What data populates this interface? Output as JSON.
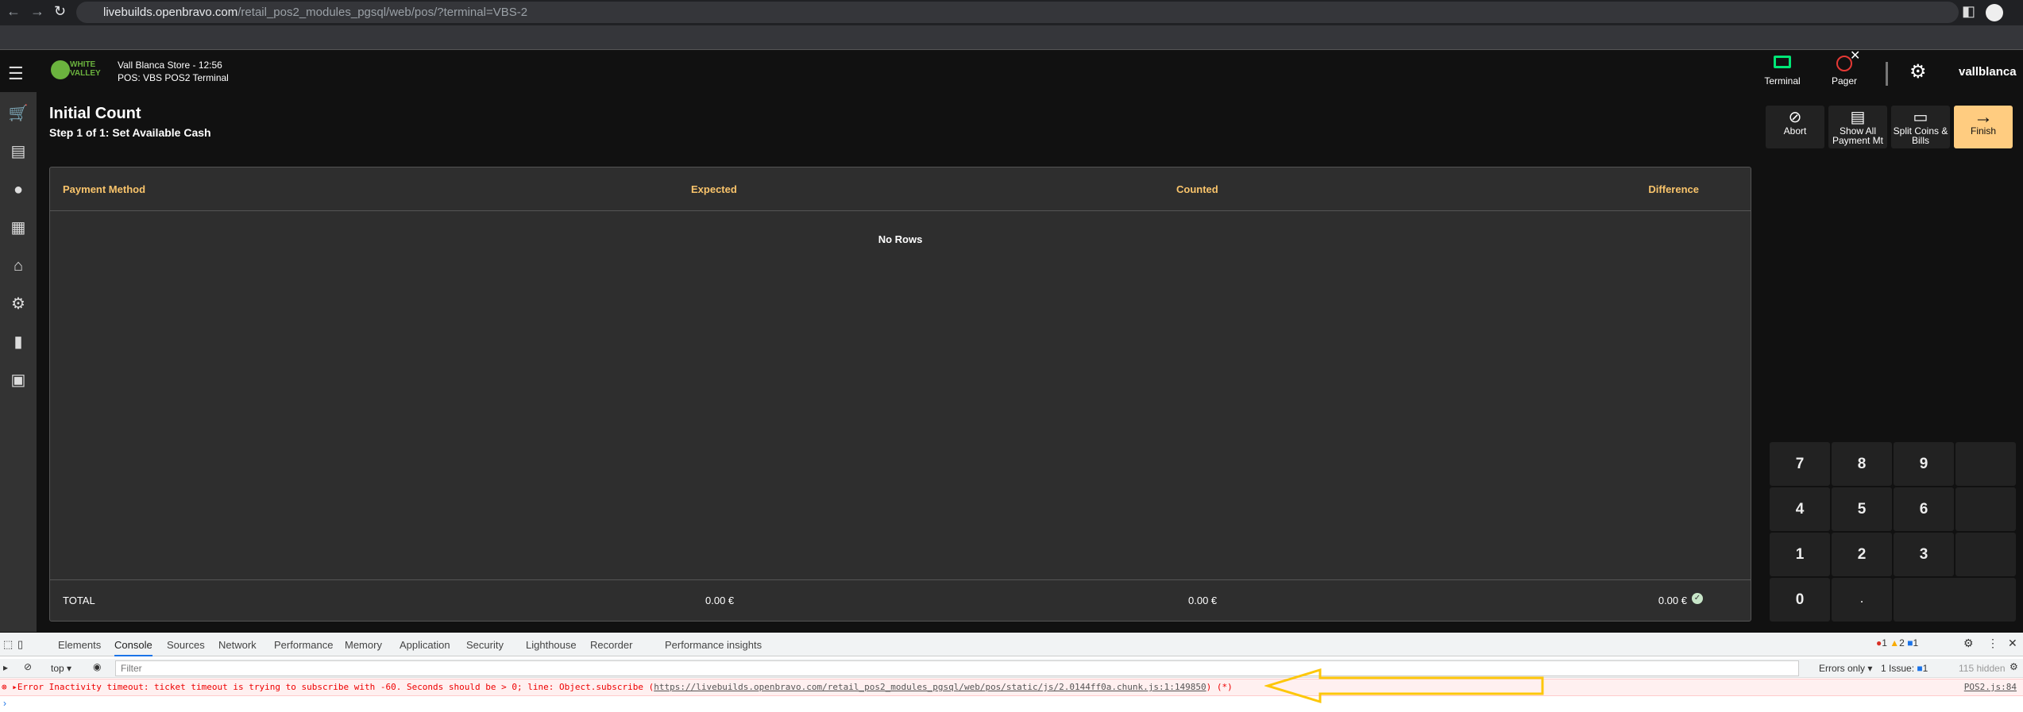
{
  "browser": {
    "url_host": "livebuilds.openbravo.com",
    "url_path": "/retail_pos2_modules_pgsql/web/pos/?terminal=VBS-2"
  },
  "header": {
    "logo_line1": "WHITE",
    "logo_line2": "VALLEY",
    "store": "Vall Blanca Store - 12:56",
    "terminal": "POS: VBS POS2 Terminal",
    "terminal_label": "Terminal",
    "pager_label": "Pager",
    "user": "vallblanca"
  },
  "page": {
    "title": "Initial Count",
    "step": "Step 1 of 1: Set Available Cash"
  },
  "actions": {
    "abort": "Abort",
    "show_all": "Show All Payment Mt",
    "split": "Split Coins & Bills",
    "finish": "Finish"
  },
  "table": {
    "columns": [
      "Payment Method",
      "Expected",
      "Counted",
      "Difference"
    ],
    "empty": "No Rows",
    "total_label": "TOTAL",
    "total_expected": "0.00 €",
    "total_counted": "0.00 €",
    "total_difference": "0.00 €"
  },
  "keypad": {
    "keys": [
      "7",
      "8",
      "9",
      "4",
      "5",
      "6",
      "1",
      "2",
      "3",
      "0",
      "."
    ]
  },
  "devtools": {
    "tabs": [
      "Elements",
      "Console",
      "Sources",
      "Network",
      "Performance",
      "Memory",
      "Application",
      "Security",
      "Lighthouse",
      "Recorder",
      "Performance insights"
    ],
    "context": "top",
    "filter_placeholder": "Filter",
    "errors_count": "1",
    "warnings_count": "2",
    "info_count": "1",
    "levels": "Errors only",
    "issues": "1 Issue:",
    "issues_count": "1",
    "hidden": "115 hidden",
    "error_text": "Error Inactivity timeout: ticket timeout is trying to subscribe with -60. Seconds should be > 0; line: Object.subscribe (",
    "error_link": "https://livebuilds.openbravo.com/retail_pos2_modules_pgsql/web/pos/static/js/2.0144ff0a.chunk.js:1:149850",
    "error_tail": ") (*)",
    "source": "POS2.js:84"
  },
  "colors": {
    "accent": "#f9c46b",
    "finish_bg": "#ffcc80",
    "terminal": "#00e676",
    "pager": "#e53935"
  }
}
